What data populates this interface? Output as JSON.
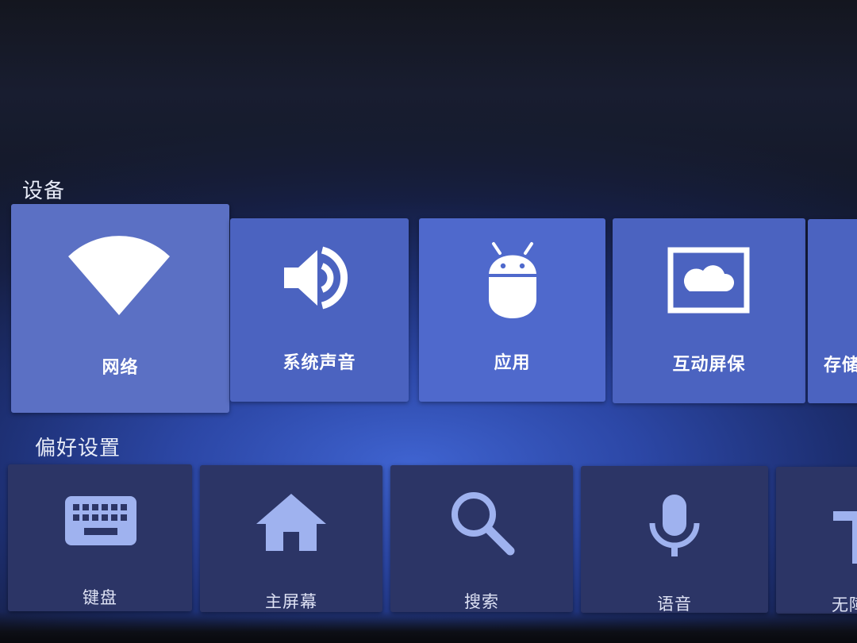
{
  "sections": {
    "devices": {
      "title": "设备",
      "items": [
        {
          "label": "网络",
          "icon": "wifi-icon"
        },
        {
          "label": "系统声音",
          "icon": "speaker-icon"
        },
        {
          "label": "应用",
          "icon": "android-icon"
        },
        {
          "label": "互动屏保",
          "icon": "screensaver-icon"
        },
        {
          "label": "存储",
          "icon": "storage-icon"
        }
      ]
    },
    "preferences": {
      "title": "偏好设置",
      "items": [
        {
          "label": "键盘",
          "icon": "keyboard-icon"
        },
        {
          "label": "主屏幕",
          "icon": "home-icon"
        },
        {
          "label": "搜索",
          "icon": "search-icon"
        },
        {
          "label": "语音",
          "icon": "microphone-icon"
        },
        {
          "label": "无障碍",
          "icon": "accessibility-icon"
        }
      ]
    }
  },
  "focused_item": "网络",
  "colors": {
    "card_focused": "#5b70c4",
    "card_device": "#4b63c0",
    "card_preference": "#2c3566",
    "icon_preference": "#9fb2ef",
    "text": "#ffffff"
  }
}
